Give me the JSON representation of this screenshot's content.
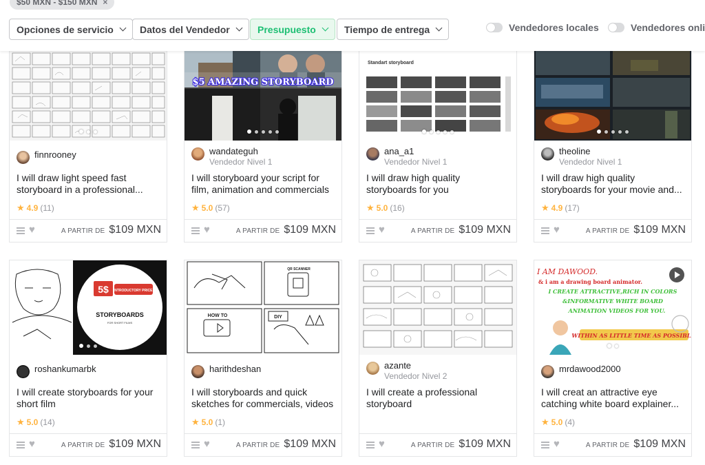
{
  "active_filter_chip": {
    "label": "$50 MXN - $150 MXN",
    "remove_icon": "close-icon"
  },
  "filters": {
    "service_options": "Opciones de servicio",
    "seller_details": "Datos del Vendedor",
    "budget": "Presupuesto",
    "delivery_time": "Tiempo de entrega"
  },
  "toggles": {
    "local_sellers": "Vendedores locales",
    "online_sellers": "Vendedores online"
  },
  "colors": {
    "accent": "#1dbf73",
    "star": "#ffb33e",
    "border": "#e4e5e7"
  },
  "gigs": [
    {
      "seller": "finnrooney",
      "level": "",
      "title": "I will draw light speed fast storyboard in a professional...",
      "rating": "4.9",
      "reviews": "(11)",
      "from": "A PARTIR DE",
      "price": "$109 MXN"
    },
    {
      "seller": "wandateguh",
      "level": "Vendedor Nivel 1",
      "title": "I will storyboard your script for film, animation and commercials",
      "rating": "5.0",
      "reviews": "(57)",
      "from": "A PARTIR DE",
      "price": "$109 MXN",
      "banner": "$5 AMAZING STORYBOARD"
    },
    {
      "seller": "ana_a1",
      "level": "Vendedor Nivel 1",
      "title": "I will draw high quality storyboards for you",
      "rating": "5.0",
      "reviews": "(16)",
      "from": "A PARTIR DE",
      "price": "$109 MXN",
      "header": "Standart storyboard"
    },
    {
      "seller": "theoline",
      "level": "Vendedor Nivel 1",
      "title": "I will draw high quality storyboards for your movie and...",
      "rating": "4.9",
      "reviews": "(17)",
      "from": "A PARTIR DE",
      "price": "$109 MXN"
    },
    {
      "seller": "roshankumarbk",
      "level": "",
      "title": "I will create storyboards for your short film",
      "rating": "5.0",
      "reviews": "(14)",
      "from": "A PARTIR DE",
      "price": "$109 MXN",
      "promo_price": "5$",
      "promo_tag": "INTRODUCTORY PRICE!",
      "promo_title": "STORYBOARDS",
      "promo_sub": "FOR SHORT FILMS"
    },
    {
      "seller": "harithdeshan",
      "level": "",
      "title": "I will storyboards and quick sketches for commercials, videos",
      "rating": "5.0",
      "reviews": "(1)",
      "from": "A PARTIR DE",
      "price": "$109 MXN",
      "sketch_labels": [
        "HOW TO",
        "DIY",
        "QR SCANNER"
      ]
    },
    {
      "seller": "azante",
      "level": "Vendedor Nivel 2",
      "title": "I will create a professional storyboard",
      "rating": "",
      "reviews": "",
      "from": "A PARTIR DE",
      "price": "$109 MXN"
    },
    {
      "seller": "mrdawood2000",
      "level": "",
      "title": "I will creat an attractive eye catching white board explainer...",
      "rating": "5.0",
      "reviews": "(4)",
      "from": "A PARTIR DE",
      "price": "$109 MXN",
      "promo_lines": [
        "I AM DAWOOD.",
        "& i am a drawing board animator.",
        "I CREATE ATTRACTIVE,RICH IN COLORS",
        "&INFORMATIVE WHITE BOARD",
        "ANIMATION VIDEOS FOR YOU.",
        "WITHIN AS LITTLE TIME AS POSSIBLE"
      ]
    }
  ]
}
